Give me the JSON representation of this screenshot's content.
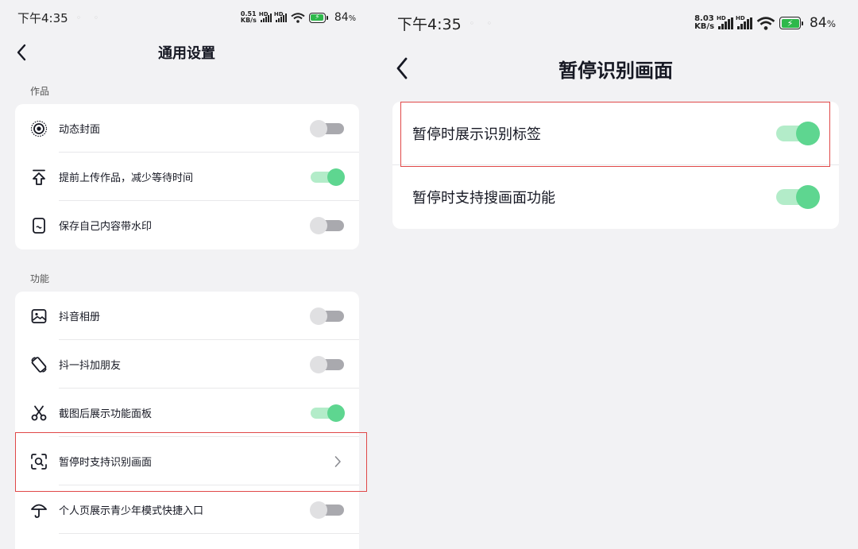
{
  "left_screen": {
    "status_bar": {
      "time": "下午4:35",
      "net_speed_value": "0.51",
      "net_speed_unit": "KB/s",
      "signal_label": "HD",
      "battery_percent": "84",
      "battery_percent_sign": "%"
    },
    "header": {
      "title": "通用设置",
      "back_icon": "chevron-left-icon"
    },
    "sections": [
      {
        "label": "作品",
        "items": [
          {
            "label": "动态封面",
            "icon": "dynamic-cover-icon",
            "control": "toggle",
            "state": "off"
          },
          {
            "label": "提前上传作品，减少等待时间",
            "icon": "upload-icon",
            "control": "toggle",
            "state": "on"
          },
          {
            "label": "保存自己内容带水印",
            "icon": "watermark-icon",
            "control": "toggle",
            "state": "off"
          }
        ]
      },
      {
        "label": "功能",
        "items": [
          {
            "label": "抖音相册",
            "icon": "photo-album-icon",
            "control": "toggle",
            "state": "off"
          },
          {
            "label": "抖一抖加朋友",
            "icon": "shake-rotate-icon",
            "control": "toggle",
            "state": "off"
          },
          {
            "label": "截图后展示功能面板",
            "icon": "scissors-icon",
            "control": "toggle",
            "state": "on"
          },
          {
            "label": "暂停时支持识别画面",
            "icon": "scan-search-icon",
            "control": "chevron",
            "highlighted": true
          },
          {
            "label": "个人页展示青少年模式快捷入口",
            "icon": "umbrella-icon",
            "control": "toggle",
            "state": "off"
          }
        ]
      }
    ]
  },
  "right_screen": {
    "status_bar": {
      "time": "下午4:35",
      "net_speed_value": "8.03",
      "net_speed_unit": "KB/s",
      "signal_label": "HD",
      "battery_percent": "84",
      "battery_percent_sign": "%"
    },
    "header": {
      "title": "暂停识别画面",
      "back_icon": "chevron-left-icon"
    },
    "items": [
      {
        "label": "暂停时展示识别标签",
        "control": "toggle",
        "state": "on",
        "highlighted": true
      },
      {
        "label": "暂停时支持搜画面功能",
        "control": "toggle",
        "state": "on"
      }
    ]
  },
  "colors": {
    "page_background": "#f2f2f4",
    "card_background": "#ffffff",
    "toggle_on_knob": "#5ed690",
    "toggle_on_track": "#b3ecc9",
    "toggle_off_knob": "#e0e0e2",
    "toggle_off_track": "#a9a9ae",
    "highlight_border": "#e04848",
    "battery_fill": "#2db84a"
  }
}
